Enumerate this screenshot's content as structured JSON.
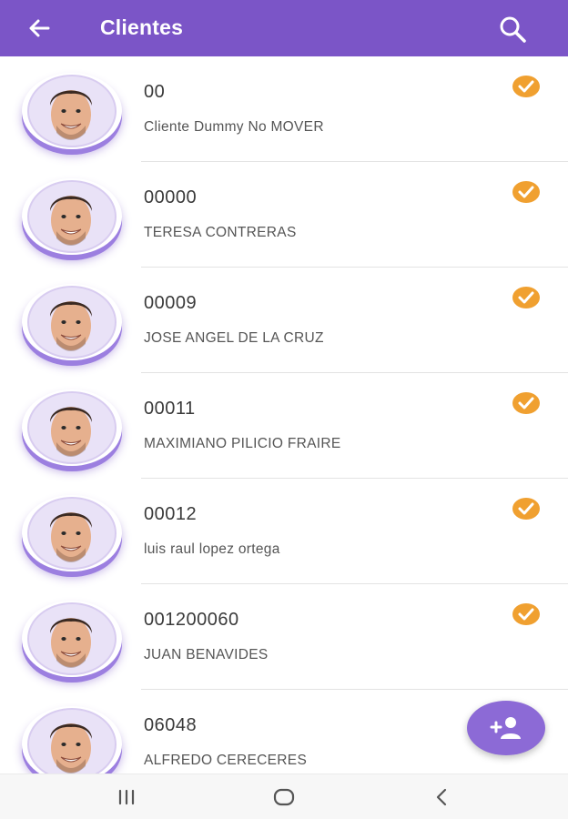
{
  "header": {
    "title": "Clientes",
    "back_icon": "arrow-left-icon",
    "search_icon": "search-icon"
  },
  "colors": {
    "primary": "#7b55c7",
    "accent_check": "#f0a030",
    "fab": "#8c6ad6"
  },
  "clients": [
    {
      "code": "00",
      "name": "Cliente Dummy No MOVER",
      "verified": true
    },
    {
      "code": "00000",
      "name": "TERESA CONTRERAS",
      "verified": true
    },
    {
      "code": "00009",
      "name": "JOSE ANGEL DE LA CRUZ",
      "verified": true
    },
    {
      "code": "00011",
      "name": "MAXIMIANO PILICIO FRAIRE",
      "verified": true
    },
    {
      "code": "00012",
      "name": "luis raul lopez ortega",
      "verified": true
    },
    {
      "code": "001200060",
      "name": "JUAN BENAVIDES",
      "verified": true
    },
    {
      "code": "06048",
      "name": "ALFREDO CERECERES",
      "verified": true
    }
  ],
  "fab": {
    "icon": "add-person-icon"
  },
  "system_nav": {
    "recents_icon": "recent-apps-icon",
    "home_icon": "home-icon",
    "back_icon": "nav-back-icon"
  }
}
